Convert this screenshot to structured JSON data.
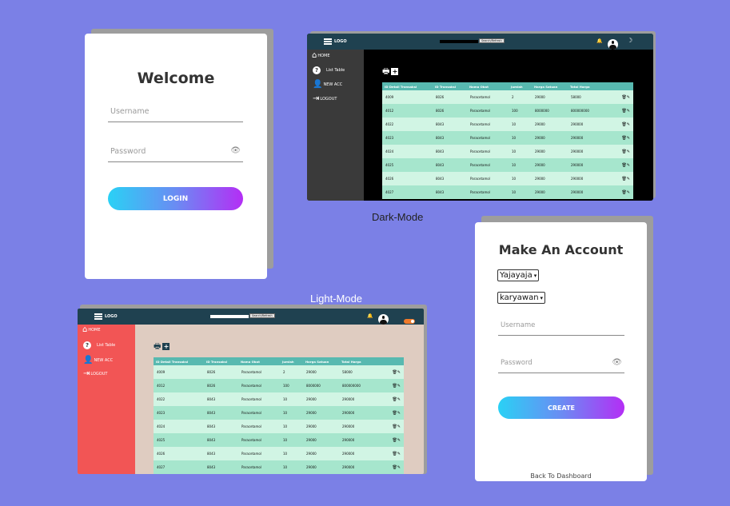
{
  "welcome": {
    "title": "Welcome",
    "username_placeholder": "Username",
    "password_placeholder": "Password",
    "login_label": "LOGIN"
  },
  "labels": {
    "dark_mode": "Dark-Mode",
    "light_mode": "Light-Mode"
  },
  "dashboard": {
    "logo": "LOGO",
    "search_button": "Search/Refresh",
    "sidebar": [
      "HOME",
      "List Table",
      "NEW ACC",
      "LOGOUT"
    ],
    "columns": [
      "ID Detail Transaksi",
      "ID Transaksi",
      "Nama Obat",
      "Jumlah",
      "Harga Satuan",
      "Total Harga"
    ],
    "rows": [
      [
        "4009",
        "8026",
        "Paracetamol",
        "2",
        "29000",
        "58000"
      ],
      [
        "4012",
        "8026",
        "Paracetamol",
        "100",
        "8000000",
        "800000000"
      ],
      [
        "4022",
        "8043",
        "Paracetamol",
        "10",
        "29000",
        "290000"
      ],
      [
        "4023",
        "8043",
        "Paracetamol",
        "10",
        "29000",
        "290000"
      ],
      [
        "4024",
        "8043",
        "Paracetamol",
        "10",
        "29000",
        "290000"
      ],
      [
        "4025",
        "8043",
        "Paracetamol",
        "10",
        "29000",
        "290000"
      ],
      [
        "4026",
        "8043",
        "Paracetamol",
        "10",
        "29000",
        "290000"
      ],
      [
        "4027",
        "8043",
        "Paracetamol",
        "10",
        "29000",
        "290000"
      ]
    ],
    "colors": {
      "topbar": "#1f4150",
      "dark_sidebar": "#3a3a3a",
      "dark_main": "#000000",
      "light_sidebar": "#f25555",
      "light_main": "#dfccc1",
      "row_light": "#d1f5e4",
      "row_dark": "#a6e6cd",
      "header": "#58b9b0"
    }
  },
  "account": {
    "title": "Make An Account",
    "select_name": "Yajayaja",
    "select_role": "karyawan",
    "username_placeholder": "Username",
    "password_placeholder": "Password",
    "create_label": "CREATE",
    "back_link": "Back To Dashboard"
  },
  "colors": {
    "background": "#7b80e6",
    "gradient": [
      "#2ad1f5",
      "#b42ef5"
    ]
  }
}
